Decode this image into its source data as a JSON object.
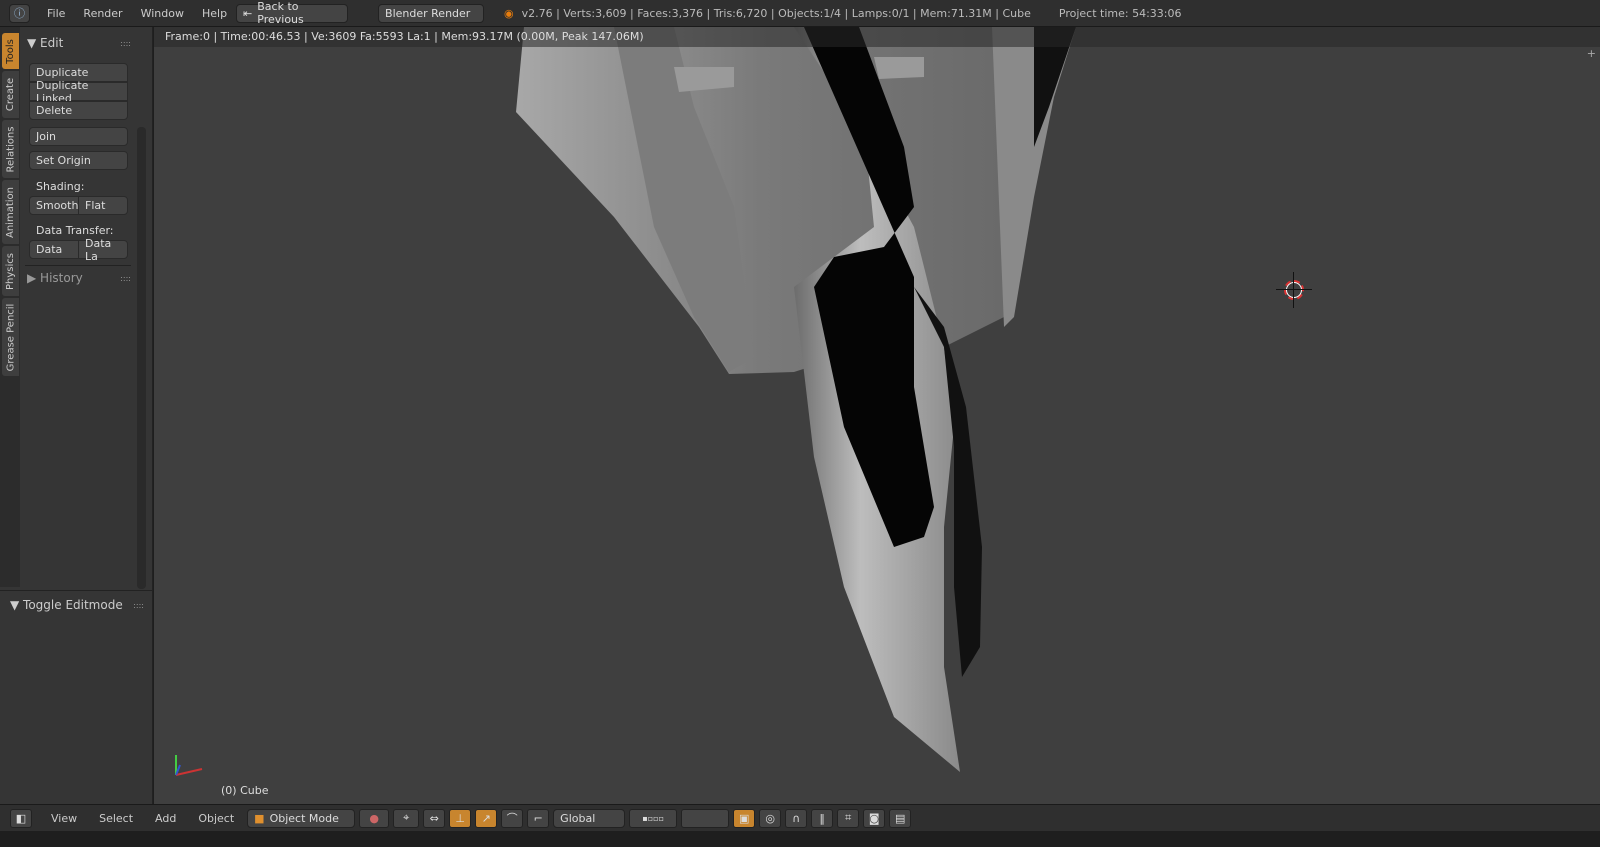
{
  "topbar": {
    "menus": [
      "File",
      "Render",
      "Window",
      "Help"
    ],
    "back_button": "Back to Previous",
    "engine": "Blender Render",
    "stats": "v2.76 | Verts:3,609 | Faces:3,376 | Tris:6,720 | Objects:1/4 | Lamps:0/1 | Mem:71.31M | Cube",
    "project_time": "Project time: 54:33:06"
  },
  "toolshelf": {
    "tabs": [
      "Tools",
      "Create",
      "Relations",
      "Animation",
      "Physics",
      "Grease Pencil"
    ],
    "edit_header": "Edit",
    "buttons": {
      "duplicate": "Duplicate",
      "duplicate_linked": "Duplicate Linked",
      "delete": "Delete",
      "join": "Join",
      "set_origin": "Set Origin",
      "smooth": "Smooth",
      "flat": "Flat",
      "data": "Data",
      "data_layers": "Data La"
    },
    "shading_label": "Shading:",
    "data_transfer_label": "Data Transfer:",
    "history_header": "History",
    "operator_header": "Toggle Editmode"
  },
  "viewport": {
    "render_info": "Frame:0 | Time:00:46.53 | Ve:3609 Fa:5593 La:1 | Mem:93.17M (0.00M, Peak 147.06M)",
    "object_label": "(0) Cube"
  },
  "bottombar": {
    "menus": [
      "View",
      "Select",
      "Add",
      "Object"
    ],
    "mode": "Object Mode",
    "orientation": "Global"
  },
  "colors": {
    "accent": "#c8852e",
    "viewport": "#3f3f3f"
  }
}
